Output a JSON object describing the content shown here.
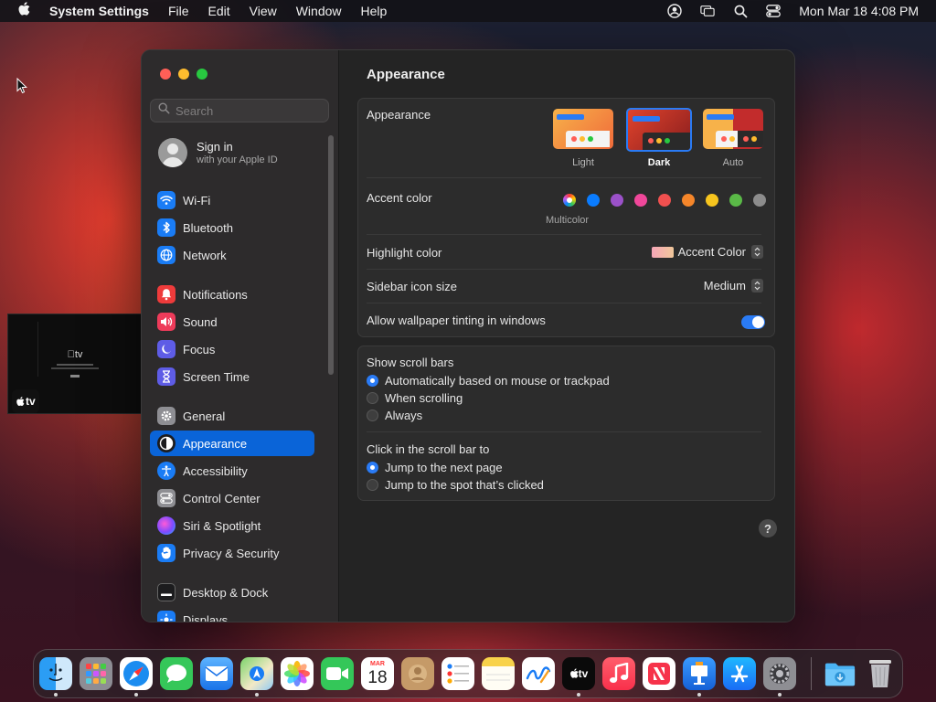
{
  "menubar": {
    "app_name": "System Settings",
    "menus": [
      "File",
      "Edit",
      "View",
      "Window",
      "Help"
    ],
    "clock": "Mon Mar 18  4:08 PM"
  },
  "thumbnail": {
    "app_logo": "tv"
  },
  "sidebar": {
    "search_placeholder": "Search",
    "signin_title": "Sign in",
    "signin_subtitle": "with your Apple ID",
    "items": [
      {
        "label": "Wi-Fi",
        "icon": "wifi-icon",
        "color": "#1a7cf5"
      },
      {
        "label": "Bluetooth",
        "icon": "bluetooth-icon",
        "color": "#1a7cf5"
      },
      {
        "label": "Network",
        "icon": "globe-icon",
        "color": "#1a7cf5"
      },
      {
        "label": "Notifications",
        "icon": "bell-icon",
        "color": "#ee3b3b"
      },
      {
        "label": "Sound",
        "icon": "speaker-icon",
        "color": "#ee3b5a"
      },
      {
        "label": "Focus",
        "icon": "moon-icon",
        "color": "#5e5ce6"
      },
      {
        "label": "Screen Time",
        "icon": "hourglass-icon",
        "color": "#5e5ce6"
      },
      {
        "label": "General",
        "icon": "gear-icon",
        "color": "#8e8e93"
      },
      {
        "label": "Appearance",
        "icon": "appearance-icon",
        "color": "#1c1c1e"
      },
      {
        "label": "Accessibility",
        "icon": "accessibility-icon",
        "color": "#1a7cf5"
      },
      {
        "label": "Control Center",
        "icon": "control-center-icon",
        "color": "#8e8e93"
      },
      {
        "label": "Siri & Spotlight",
        "icon": "siri-icon",
        "color": "#b04ad8"
      },
      {
        "label": "Privacy & Security",
        "icon": "hand-icon",
        "color": "#1a7cf5"
      },
      {
        "label": "Desktop & Dock",
        "icon": "dock-icon",
        "color": "#1c1c1e"
      },
      {
        "label": "Displays",
        "icon": "sun-icon",
        "color": "#1a7cf5"
      }
    ],
    "active": "Appearance"
  },
  "main": {
    "title": "Appearance",
    "appearance_label": "Appearance",
    "modes": [
      "Light",
      "Dark",
      "Auto"
    ],
    "selected_mode": "Dark",
    "accent_label": "Accent color",
    "accent_colors": [
      "multicolor",
      "#0a7cff",
      "#9b51c9",
      "#f0479a",
      "#f0504f",
      "#f5862a",
      "#f7c51e",
      "#5ab947",
      "#8c8c8c"
    ],
    "accent_caption": "Multicolor",
    "highlight_label": "Highlight color",
    "highlight_value": "Accent Color",
    "icon_size_label": "Sidebar icon size",
    "icon_size_value": "Medium",
    "tinting_label": "Allow wallpaper tinting in windows",
    "tinting_on": true,
    "scrollbars_label": "Show scroll bars",
    "scrollbar_options": [
      "Automatically based on mouse or trackpad",
      "When scrolling",
      "Always"
    ],
    "scrollbar_selected": 0,
    "click_label": "Click in the scroll bar to",
    "click_options": [
      "Jump to the next page",
      "Jump to the spot that’s clicked"
    ],
    "click_selected": 0,
    "help_label": "?"
  },
  "dock": {
    "apps": [
      "finder-icon",
      "launchpad-icon",
      "safari-icon",
      "messages-icon",
      "mail-icon",
      "maps-icon",
      "photos-icon",
      "facetime-icon",
      "calendar-icon",
      "contacts-icon",
      "reminders-icon",
      "notes-icon",
      "freeform-icon",
      "appletv-icon",
      "music-icon",
      "news-icon",
      "keynote-icon",
      "appstore-icon",
      "settings-icon",
      "downloads-icon",
      "trash-icon"
    ],
    "calendar_month": "MAR",
    "calendar_day": "18",
    "tv_label": "tv"
  }
}
